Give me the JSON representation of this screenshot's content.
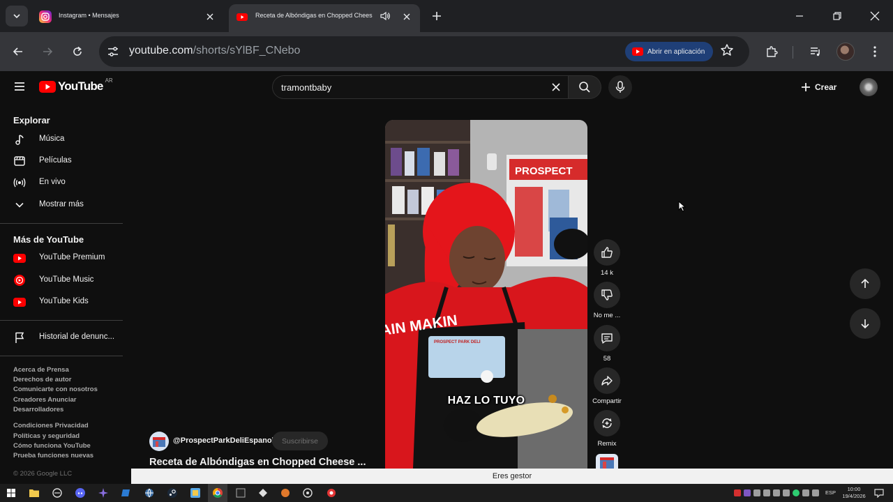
{
  "browser": {
    "tabs": [
      {
        "title": "Instagram • Mensajes",
        "favicon": "instagram-icon",
        "active": false
      },
      {
        "title": "Receta de Albóndigas en Chopped Cheese 😋 #",
        "favicon": "youtube-icon",
        "active": true
      }
    ],
    "url_host": "youtube.com",
    "url_path": "/shorts/sYlBF_CNebo",
    "open_app_label": "Abrir en aplicación",
    "colors": {
      "tabbar": "#1f2023",
      "toolbar": "#35363a",
      "omnibox": "#202124",
      "open_app": "#1f3f77"
    }
  },
  "header": {
    "logo_text": "YouTube",
    "country_code": "AR",
    "search_value": "tramontbaby",
    "create_label": "Crear",
    "colors": {
      "brand_red": "#ff0000",
      "background": "#0f0f0f"
    }
  },
  "sidebar": {
    "explore_heading": "Explorar",
    "explore_items": [
      {
        "label": "Música",
        "icon": "music-note-icon"
      },
      {
        "label": "Películas",
        "icon": "clapperboard-icon"
      },
      {
        "label": "En vivo",
        "icon": "live-broadcast-icon"
      },
      {
        "label": "Mostrar más",
        "icon": "chevron-down-icon"
      }
    ],
    "more_heading": "Más de YouTube",
    "more_items": [
      {
        "label": "YouTube Premium",
        "icon": "youtube-premium-icon"
      },
      {
        "label": "YouTube Music",
        "icon": "youtube-music-icon"
      },
      {
        "label": "YouTube Kids",
        "icon": "youtube-kids-icon"
      }
    ],
    "report_item": {
      "label": "Historial de denunc...",
      "icon": "flag-icon"
    },
    "footer_lines_1": [
      "Acerca de  Prensa",
      "Derechos de autor",
      "Comunicarte con nosotros",
      "Creadores  Anunciar",
      "Desarrolladores"
    ],
    "footer_lines_2": [
      "Condiciones  Privacidad",
      "Políticas y seguridad",
      "Cómo funciona YouTube",
      "Prueba funciones nuevas"
    ],
    "copyright": "© 2026 Google LLC"
  },
  "short": {
    "caption": "HAZ LO TUYO",
    "store_sign": "PROSPECT",
    "apron_text": "PROSPECT PARK DELI",
    "shirt_text": "AIN MAKIN",
    "channel": "@ProspectParkDeliEspanol",
    "subscribe_label": "Suscribirse",
    "title": "Receta de Albóndigas en Chopped Cheese ...",
    "actions": {
      "likes": "14 k",
      "dislike": "No me ...",
      "comments": "58",
      "share": "Compartir",
      "remix": "Remix"
    }
  },
  "banner": {
    "text": "Eres gestor"
  },
  "taskbar": {
    "language": "ESP",
    "time": "10:00",
    "date": "19/4/2026"
  }
}
